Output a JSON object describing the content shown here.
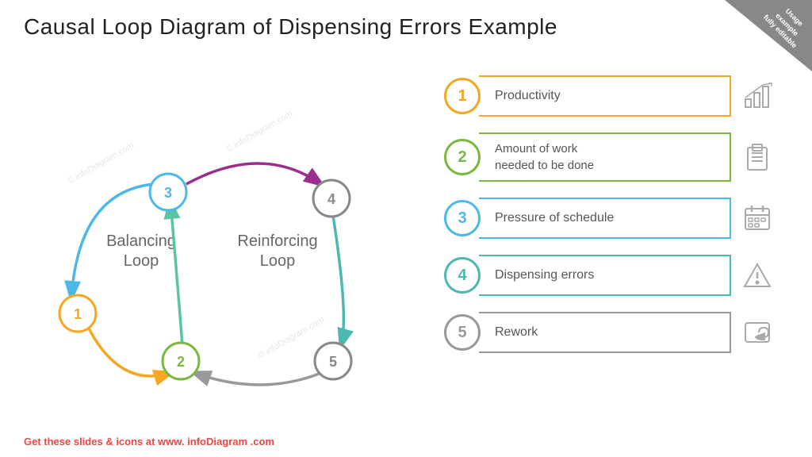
{
  "title": "Causal Loop Diagram of Dispensing Errors Example",
  "badge": {
    "line1": "Usage",
    "line2": "example",
    "line3": "fully editable"
  },
  "loopLabels": {
    "balancing": "Balancing Loop",
    "reinforcing": "Reinforcing Loop"
  },
  "listItems": [
    {
      "num": "1",
      "label": "Productivity",
      "color": "#f5a623"
    },
    {
      "num": "2",
      "label": "Amount of work\nneeded to be done",
      "color": "#7ab840"
    },
    {
      "num": "3",
      "label": "Pressure of schedule",
      "color": "#4db8e8"
    },
    {
      "num": "4",
      "label": "Dispensing errors",
      "color": "#4db8b0"
    },
    {
      "num": "5",
      "label": "Rework",
      "color": "#999999"
    }
  ],
  "footer": {
    "prefix": "Get these slides & icons at www.",
    "brand": "infoDiagram",
    "suffix": ".com"
  }
}
